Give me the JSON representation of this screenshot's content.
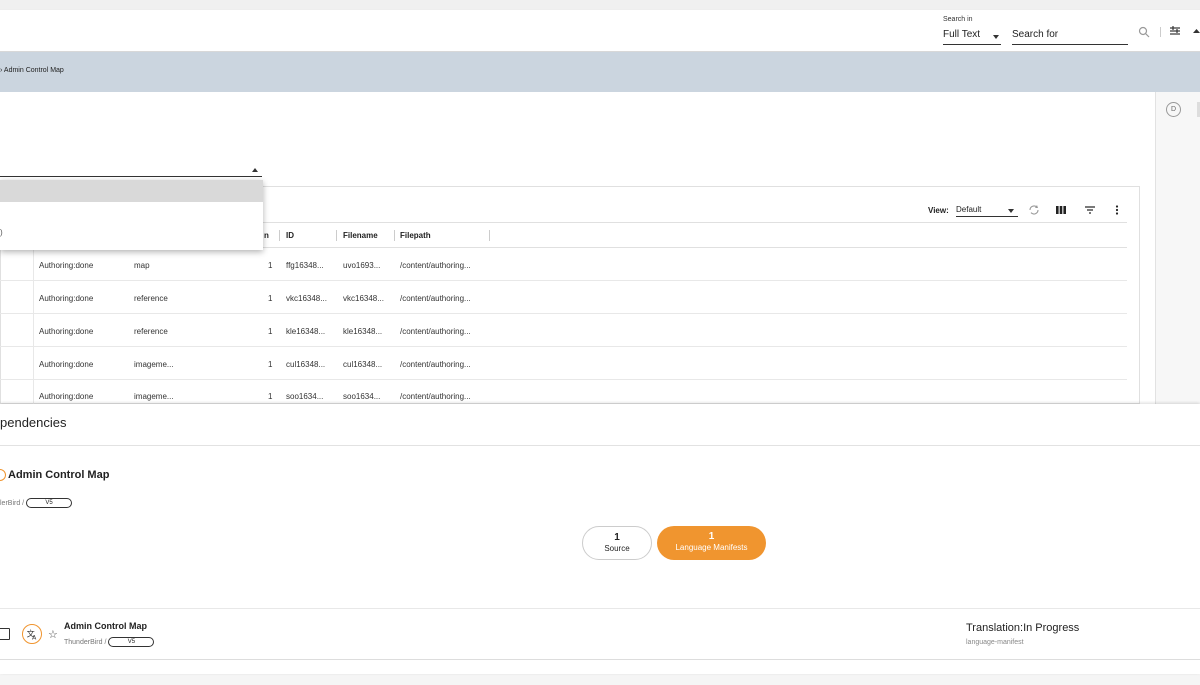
{
  "header": {
    "search_in_label": "Search in",
    "search_mode": "Full Text",
    "search_placeholder": "Search for"
  },
  "breadcrumb": {
    "current": "Admin Control Map"
  },
  "table": {
    "view_label": "View:",
    "view_value": "Default",
    "columns": [
      "n",
      "ID",
      "Filename",
      "Filepath"
    ],
    "rows": [
      {
        "status": "Authoring:done",
        "type": "map",
        "num": "1",
        "id": "ffg16348...",
        "filename": "uvo1693...",
        "filepath": "/content/authoring..."
      },
      {
        "status": "Authoring:done",
        "type": "reference",
        "num": "1",
        "id": "vkc16348...",
        "filename": "vkc16348...",
        "filepath": "/content/authoring..."
      },
      {
        "status": "Authoring:done",
        "type": "reference",
        "num": "1",
        "id": "kle16348...",
        "filename": "kle16348...",
        "filepath": "/content/authoring..."
      },
      {
        "status": "Authoring:done",
        "type": "imageme...",
        "num": "1",
        "id": "cul16348...",
        "filename": "cul16348...",
        "filepath": "/content/authoring..."
      },
      {
        "status": "Authoring:done",
        "type": "imageme...",
        "num": "1",
        "id": "soo1634...",
        "filename": "soo1634...",
        "filepath": "/content/authoring..."
      }
    ]
  },
  "dropdown": {
    "partial_item": ")"
  },
  "rail": {
    "d_badge": "D"
  },
  "dependencies": {
    "title": "pendencies",
    "map_title": "Admin Control Map",
    "map_sub": "lerBird /",
    "map_version": "V5",
    "segments": [
      {
        "count": "1",
        "label": "Source"
      },
      {
        "count": "1",
        "label": "Language Manifests"
      }
    ],
    "result": {
      "title": "Admin Control Map",
      "sub": "ThunderBird /",
      "version": "V5",
      "status": "Translation:In Progress",
      "type": "language-manifest"
    }
  },
  "colors": {
    "accent": "#f0952f",
    "breadcrumb_bg": "#cbd5df"
  }
}
